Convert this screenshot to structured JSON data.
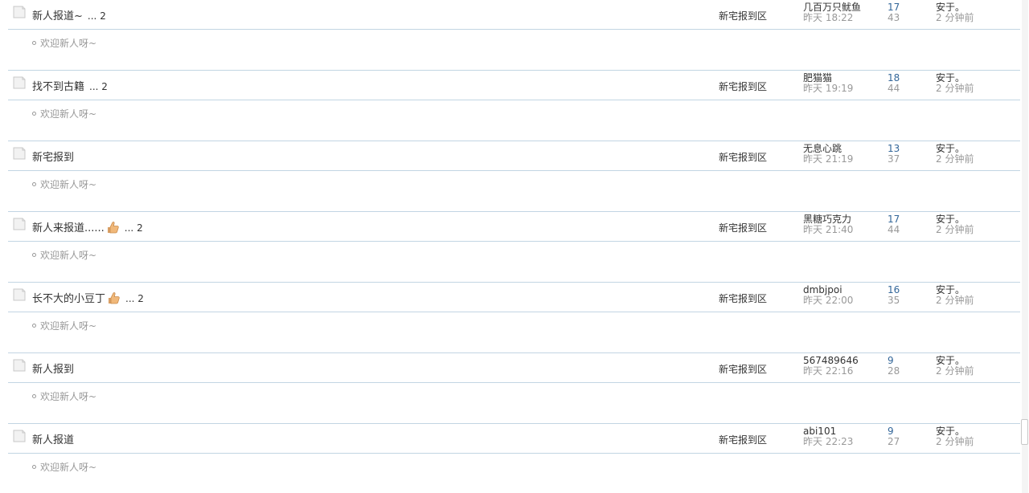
{
  "colors": {
    "separator": "#c2d5e3",
    "muted_text": "#999999",
    "reply_count": "#336699",
    "main_text": "#333333"
  },
  "threads": [
    {
      "title": "新人报道~",
      "has_thumb_icon": false,
      "ellipsis": "...",
      "page_count": "2",
      "forum": "新宅报到区",
      "author": "几百万只鱿鱼",
      "author_time": "昨天 18:22",
      "replies": "17",
      "views": "43",
      "last_poster": "安于。",
      "last_time": "2 分钟前",
      "reply_preview": "欢迎新人呀~"
    },
    {
      "title": "找不到古籍",
      "has_thumb_icon": false,
      "ellipsis": "...",
      "page_count": "2",
      "forum": "新宅报到区",
      "author": "肥猫猫",
      "author_time": "昨天 19:19",
      "replies": "18",
      "views": "44",
      "last_poster": "安于。",
      "last_time": "2 分钟前",
      "reply_preview": "欢迎新人呀~"
    },
    {
      "title": "新宅报到",
      "has_thumb_icon": false,
      "ellipsis": "",
      "page_count": "",
      "forum": "新宅报到区",
      "author": "无息心跳",
      "author_time": "昨天 21:19",
      "replies": "13",
      "views": "37",
      "last_poster": "安于。",
      "last_time": "2 分钟前",
      "reply_preview": "欢迎新人呀~"
    },
    {
      "title": "新人来报道......",
      "has_thumb_icon": true,
      "ellipsis": "...",
      "page_count": "2",
      "forum": "新宅报到区",
      "author": "黑糖巧克力",
      "author_time": "昨天 21:40",
      "replies": "17",
      "views": "44",
      "last_poster": "安于。",
      "last_time": "2 分钟前",
      "reply_preview": "欢迎新人呀~"
    },
    {
      "title": "长不大的小豆丁",
      "has_thumb_icon": true,
      "ellipsis": "...",
      "page_count": "2",
      "forum": "新宅报到区",
      "author": "dmbjpoi",
      "author_time": "昨天 22:00",
      "replies": "16",
      "views": "35",
      "last_poster": "安于。",
      "last_time": "2 分钟前",
      "reply_preview": "欢迎新人呀~"
    },
    {
      "title": "新人报到",
      "has_thumb_icon": false,
      "ellipsis": "",
      "page_count": "",
      "forum": "新宅报到区",
      "author": "567489646",
      "author_time": "昨天 22:16",
      "replies": "9",
      "views": "28",
      "last_poster": "安于。",
      "last_time": "2 分钟前",
      "reply_preview": "欢迎新人呀~"
    },
    {
      "title": "新人报道",
      "has_thumb_icon": false,
      "ellipsis": "",
      "page_count": "",
      "forum": "新宅报到区",
      "author": "abi101",
      "author_time": "昨天 22:23",
      "replies": "9",
      "views": "27",
      "last_poster": "安于。",
      "last_time": "2 分钟前",
      "reply_preview": "欢迎新人呀~"
    }
  ]
}
